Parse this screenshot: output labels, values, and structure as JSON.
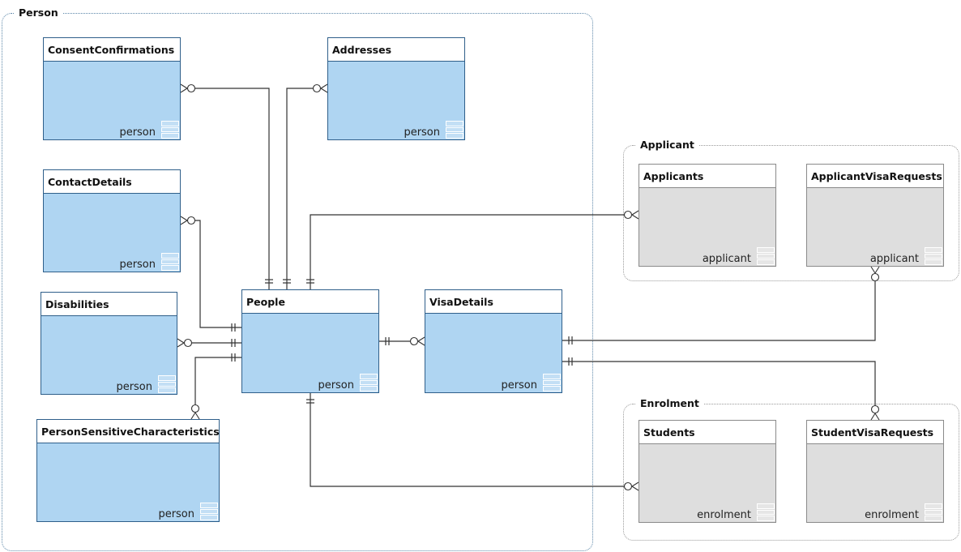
{
  "groups": [
    {
      "id": "person",
      "label": "Person",
      "style": "blue"
    },
    {
      "id": "applicant",
      "label": "Applicant",
      "style": "gray"
    },
    {
      "id": "enrolment",
      "label": "Enrolment",
      "style": "gray"
    }
  ],
  "tables": [
    {
      "id": "consent",
      "name": "ConsentConfirmations",
      "schema": "person",
      "style": "blue"
    },
    {
      "id": "addresses",
      "name": "Addresses",
      "schema": "person",
      "style": "blue"
    },
    {
      "id": "contact",
      "name": "ContactDetails",
      "schema": "person",
      "style": "blue"
    },
    {
      "id": "disabilities",
      "name": "Disabilities",
      "schema": "person",
      "style": "blue"
    },
    {
      "id": "people",
      "name": "People",
      "schema": "person",
      "style": "blue"
    },
    {
      "id": "visa",
      "name": "VisaDetails",
      "schema": "person",
      "style": "blue"
    },
    {
      "id": "psc",
      "name": "PersonSensitiveCharacteristics",
      "schema": "person",
      "style": "blue"
    },
    {
      "id": "applicants",
      "name": "Applicants",
      "schema": "applicant",
      "style": "gray"
    },
    {
      "id": "avr",
      "name": "ApplicantVisaRequests",
      "schema": "applicant",
      "style": "gray"
    },
    {
      "id": "students",
      "name": "Students",
      "schema": "enrolment",
      "style": "gray"
    },
    {
      "id": "svr",
      "name": "StudentVisaRequests",
      "schema": "enrolment",
      "style": "gray"
    }
  ],
  "relationships": [
    {
      "from": "people",
      "to": "consent",
      "from_card": "one-and-only-one",
      "to_card": "zero-or-many"
    },
    {
      "from": "people",
      "to": "addresses",
      "from_card": "one-and-only-one",
      "to_card": "zero-or-many"
    },
    {
      "from": "people",
      "to": "contact",
      "from_card": "one-and-only-one",
      "to_card": "zero-or-many"
    },
    {
      "from": "people",
      "to": "disabilities",
      "from_card": "one-and-only-one",
      "to_card": "zero-or-many"
    },
    {
      "from": "people",
      "to": "psc",
      "from_card": "one-and-only-one",
      "to_card": "zero-or-many"
    },
    {
      "from": "people",
      "to": "visa",
      "from_card": "one-and-only-one",
      "to_card": "zero-or-many"
    },
    {
      "from": "people",
      "to": "applicants",
      "from_card": "one-and-only-one",
      "to_card": "zero-or-many"
    },
    {
      "from": "people",
      "to": "students",
      "from_card": "one-and-only-one",
      "to_card": "zero-or-many"
    },
    {
      "from": "visa",
      "to": "avr",
      "from_card": "one-and-only-one",
      "to_card": "zero-or-many"
    },
    {
      "from": "visa",
      "to": "svr",
      "from_card": "one-and-only-one",
      "to_card": "zero-or-many"
    }
  ],
  "colors": {
    "entity_blue": "#afd5f2",
    "entity_blue_border": "#2f5f8a",
    "entity_gray": "#dedede",
    "entity_gray_border": "#8a8a8a",
    "line": "#333333"
  },
  "icons": {
    "schema": "table-stack-icon"
  }
}
